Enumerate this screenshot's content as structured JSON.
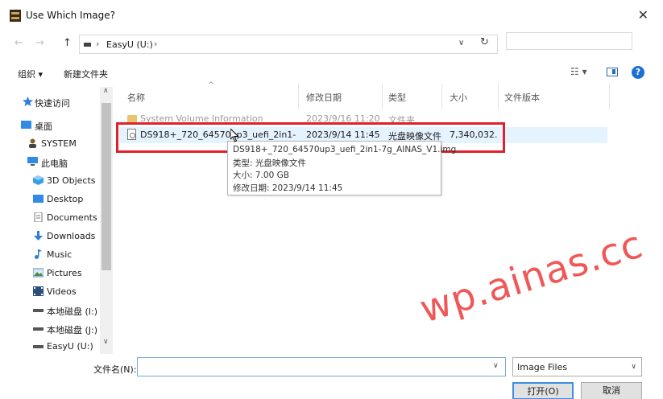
{
  "window": {
    "title": "Use Which Image?",
    "close_glyph": "✕"
  },
  "address": {
    "back_glyph": "←",
    "forward_glyph": "→",
    "up_glyph": "↑",
    "sep": "›",
    "path": "EasyU (U:)",
    "dropdown_glyph": "∨",
    "refresh_glyph": "↻",
    "search_placeholder": ""
  },
  "toolbar": {
    "organize": "组织 ▾",
    "new_folder": "新建文件夹",
    "view_glyph": "☷ ▾",
    "help": "?"
  },
  "nav": {
    "scroll_up": "∧",
    "scroll_down": "∨",
    "items": [
      {
        "label": "快速访问",
        "icon": "star-icon"
      },
      {
        "label": "桌面",
        "icon": "desktop-icon"
      },
      {
        "label": "SYSTEM",
        "icon": "user-icon"
      },
      {
        "label": "此电脑",
        "icon": "computer-icon"
      },
      {
        "label": "3D Objects",
        "icon": "cube-icon"
      },
      {
        "label": "Desktop",
        "icon": "desktop-icon"
      },
      {
        "label": "Documents",
        "icon": "document-icon"
      },
      {
        "label": "Downloads",
        "icon": "download-icon"
      },
      {
        "label": "Music",
        "icon": "music-icon"
      },
      {
        "label": "Pictures",
        "icon": "picture-icon"
      },
      {
        "label": "Videos",
        "icon": "video-icon"
      },
      {
        "label": "本地磁盘 (I:)",
        "icon": "drive-icon"
      },
      {
        "label": "本地磁盘 (J:)",
        "icon": "drive-icon"
      },
      {
        "label": "EasyU (U:)",
        "icon": "drive-icon"
      }
    ]
  },
  "columns": {
    "sort_caret": "^",
    "name": "名称",
    "modified": "修改日期",
    "type": "类型",
    "size": "大小",
    "version": "文件版本"
  },
  "files": [
    {
      "name": "System Volume Information",
      "modified": "2023/9/16 11:20",
      "type": "文件夹",
      "size": "",
      "icon": "folder-icon"
    },
    {
      "name": "DS918+_720_64570up3_uefi_2in1-7g_...",
      "modified": "2023/9/14 11:45",
      "type": "光盘映像文件",
      "size": "7,340,032...",
      "icon": "disc-image-icon"
    }
  ],
  "tooltip": {
    "line1": "DS918+_720_64570up3_uefi_2in1-7g_AINAS_V1.img",
    "line2": "类型: 光盘映像文件",
    "line3": "大小: 7.00 GB",
    "line4": "修改日期: 2023/9/14 11:45"
  },
  "watermark": "wp.ainas.cc",
  "bottom": {
    "filename_label": "文件名(N):",
    "filename_value": "",
    "filetype": "Image Files",
    "open": "打开(O)",
    "cancel": "取消"
  },
  "colors": {
    "highlight": "#e0202a",
    "watermark": "#ef4a4a",
    "accent": "#1d6fd6"
  }
}
